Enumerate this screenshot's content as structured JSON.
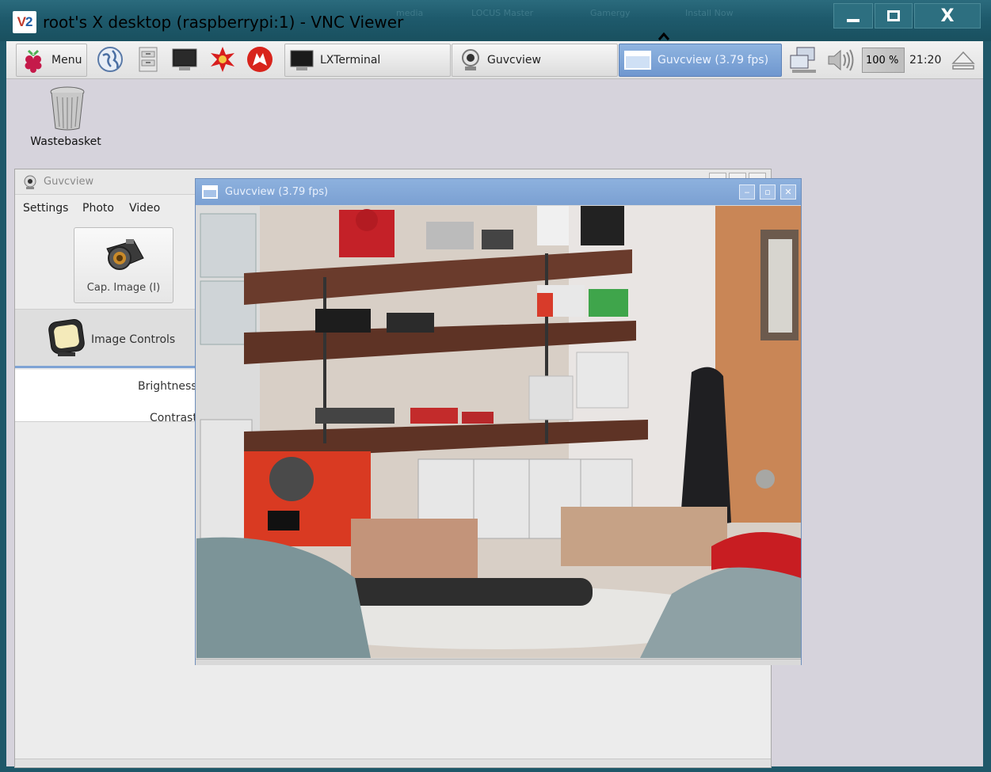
{
  "vnc": {
    "title": "root's X desktop (raspberrypi:1) - VNC Viewer",
    "logo": "V2",
    "close_label": "X"
  },
  "panel": {
    "menu_label": "Menu",
    "launchers": [
      "browser-icon",
      "file-manager-icon",
      "terminal-icon",
      "mathematica-icon",
      "wolfram-icon"
    ],
    "tasks": [
      {
        "label": "LXTerminal",
        "icon": "terminal-icon"
      },
      {
        "label": "Guvcview",
        "icon": "webcam-icon"
      },
      {
        "label": "Guvcview  (3.79 fps)",
        "icon": "window-icon",
        "active": true
      }
    ],
    "cpu_usage": "100 %",
    "clock": "21:20"
  },
  "desktop": {
    "icons": [
      {
        "label": "Wastebasket",
        "icon": "trash-icon"
      }
    ]
  },
  "guvcview_controls": {
    "title": "Guvcview",
    "menu": [
      "Settings",
      "Photo",
      "Video"
    ],
    "capture_button": "Cap. Image (I)",
    "tab_label": "Image Controls",
    "controls": [
      "Brightness",
      "Contrast"
    ]
  },
  "video_window": {
    "title": "Guvcview  (3.79 fps)",
    "content": "live camera image"
  },
  "colors": {
    "vnc_title_bg": "#1e5a6c",
    "desktop_bg": "#d6d3dc",
    "active_task": "#7ba0d2",
    "video_titlebar": "#8db1de"
  }
}
